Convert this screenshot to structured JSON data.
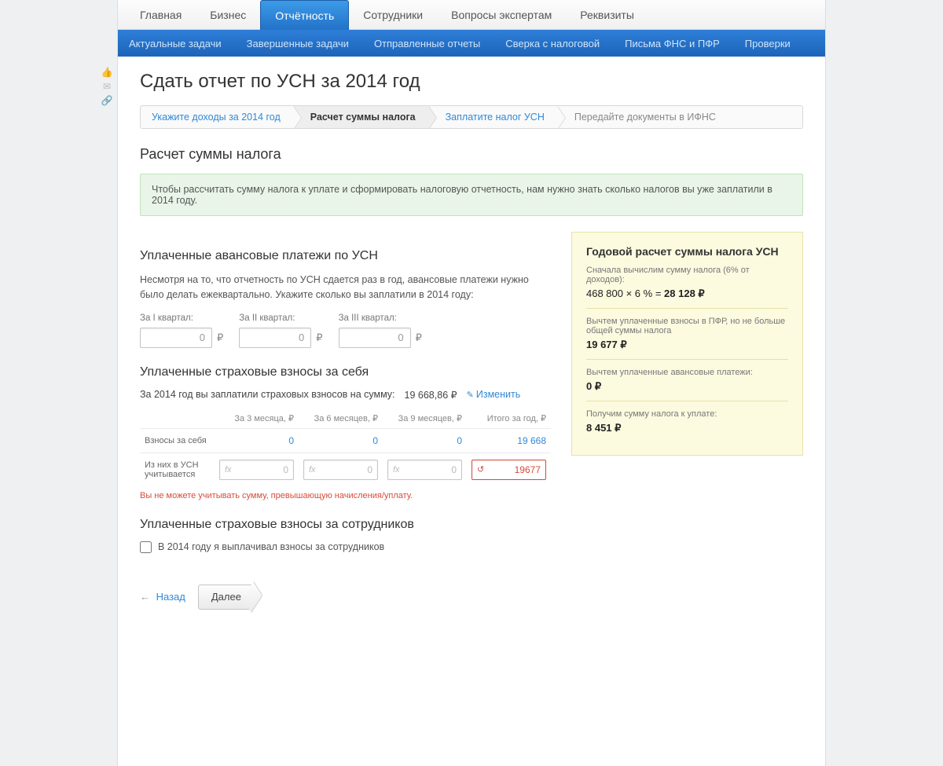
{
  "topnav": {
    "items": [
      "Главная",
      "Бизнес",
      "Отчётность",
      "Сотрудники",
      "Вопросы экспертам",
      "Реквизиты"
    ],
    "activeIndex": 2
  },
  "subnav": {
    "items": [
      "Актуальные задачи",
      "Завершенные задачи",
      "Отправленные отчеты",
      "Сверка с налоговой",
      "Письма ФНС и ПФР",
      "Проверки"
    ]
  },
  "page": {
    "title": "Сдать отчет по УСН за 2014 год",
    "subtitle": "Расчет суммы налога"
  },
  "steps": {
    "items": [
      "Укажите доходы за 2014 год",
      "Расчет суммы налога",
      "Заплатите налог УСН",
      "Передайте документы в ИФНС"
    ],
    "activeIndex": 1
  },
  "alert": "Чтобы рассчитать сумму налога к уплате и сформировать налоговую отчетность, нам нужно знать сколько налогов вы уже заплатили в 2014 году.",
  "advance": {
    "heading": "Уплаченные авансовые платежи по УСН",
    "text": "Несмотря на то, что отчетность по УСН сдается раз в год, авансовые платежи нужно было делать ежеквартально. Укажите сколько вы заплатили в 2014 году:",
    "q1_label": "За I квартал:",
    "q1_value": "0",
    "q2_label": "За II квартал:",
    "q2_value": "0",
    "q3_label": "За III квартал:",
    "q3_value": "0",
    "ruble": "₽"
  },
  "insurance": {
    "heading": "Уплаченные страховые взносы за себя",
    "summary_label": "За 2014 год вы заплатили страховых взносов на сумму:",
    "summary_value": "19 668,86 ₽",
    "edit_label": "Изменить",
    "cols": [
      "За 3 месяца, ₽",
      "За 6 месяцев, ₽",
      "За 9 месяцев, ₽",
      "Итого за год, ₽"
    ],
    "row1_label": "Взносы за себя",
    "row1_v1": "0",
    "row1_v2": "0",
    "row1_v3": "0",
    "row1_total": "19 668",
    "row2_label": "Из них в УСН учитывается",
    "fx_hint": "fx",
    "row2_ph": "0",
    "row2_total": "19677",
    "error": "Вы не можете учитывать сумму, превышающую начисления/уплату."
  },
  "employees": {
    "heading": "Уплаченные страховые взносы за сотрудников",
    "checkbox_label": "В 2014 году я выплачивал взносы за сотрудников"
  },
  "actions": {
    "back": "Назад",
    "next": "Далее",
    "arrow": "←"
  },
  "sidebox": {
    "title": "Годовой расчет суммы налога УСН",
    "line1": "Сначала вычислим сумму налога (6% от доходов):",
    "calc1_a": "468 800 × 6 % = ",
    "calc1_b": "28 128 ₽",
    "line2": "Вычтем уплаченные взносы в ПФР, но не больше общей суммы налога",
    "val2": "19 677 ₽",
    "line3": "Вычтем уплаченные авансовые платежи:",
    "val3": "0 ₽",
    "line4": "Получим сумму налога к уплате:",
    "val4": "8 451 ₽"
  }
}
